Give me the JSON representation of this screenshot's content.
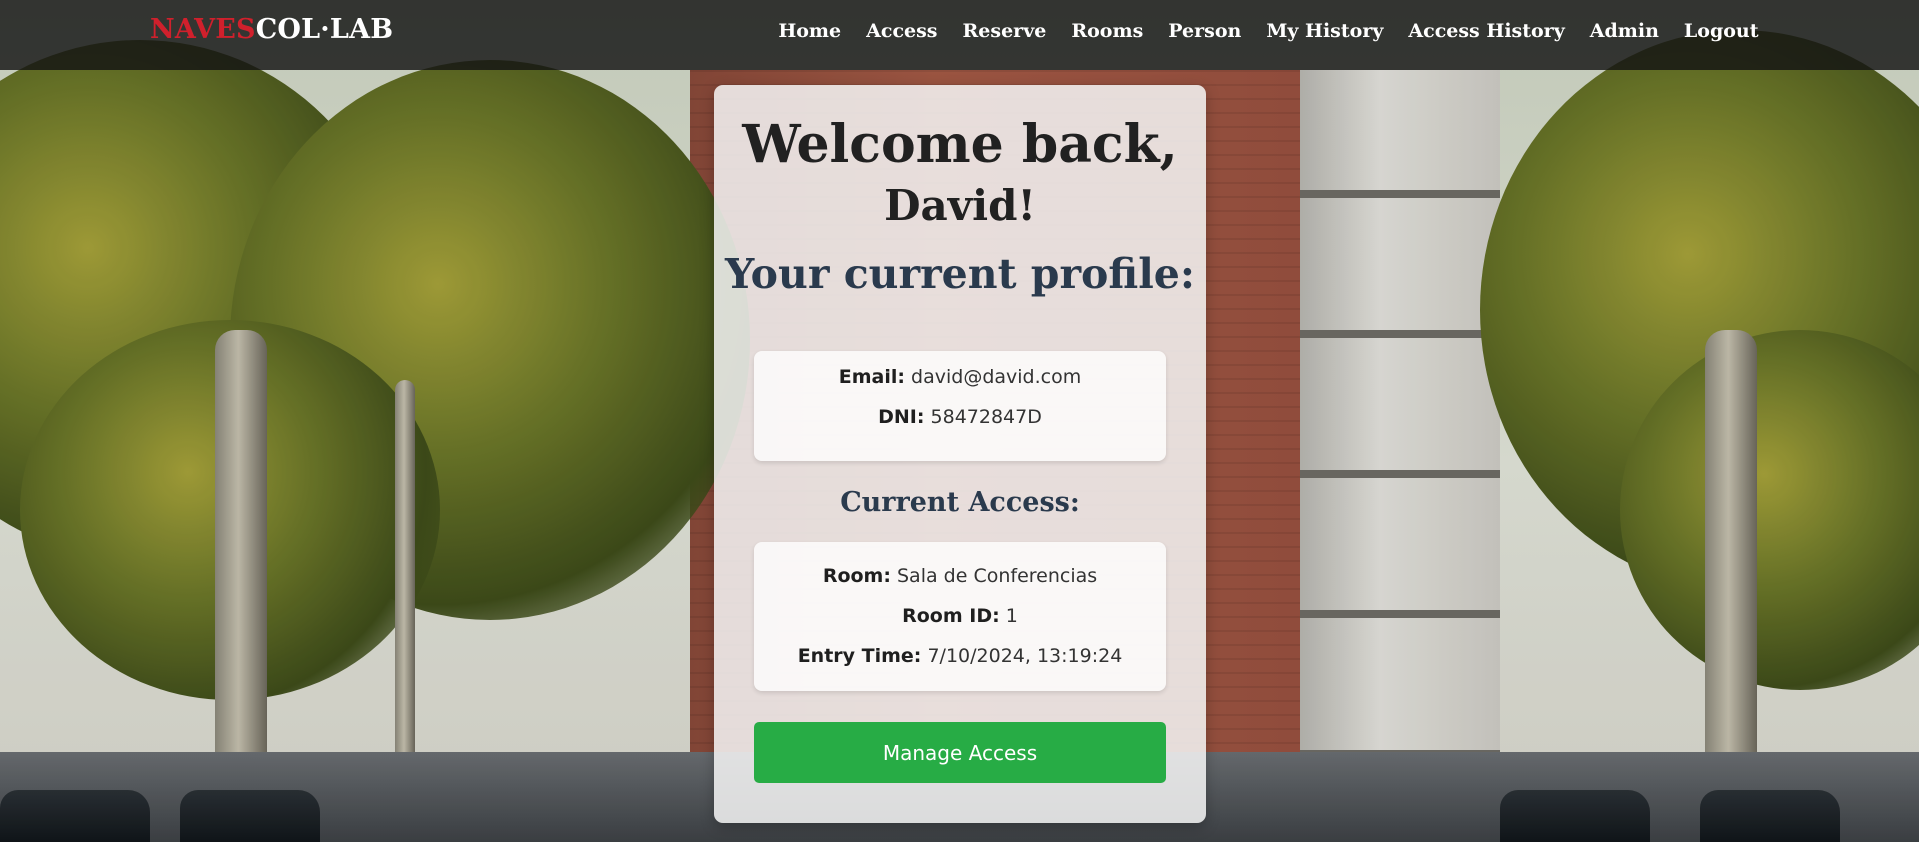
{
  "brand": {
    "part1": "NAVES",
    "part2": "COL·LAB"
  },
  "nav": [
    {
      "label": "Home"
    },
    {
      "label": "Access"
    },
    {
      "label": "Reserve"
    },
    {
      "label": "Rooms"
    },
    {
      "label": "Person"
    },
    {
      "label": "My History"
    },
    {
      "label": "Access History"
    },
    {
      "label": "Admin"
    },
    {
      "label": "Logout"
    }
  ],
  "welcome": {
    "greeting": "Welcome back,",
    "name": "David!"
  },
  "profile": {
    "title": "Your current profile:",
    "email_label": "Email:",
    "email_value": "david@david.com",
    "dni_label": "DNI:",
    "dni_value": "58472847D"
  },
  "access": {
    "title": "Current Access:",
    "room_label": "Room:",
    "room_value": "Sala de Conferencias",
    "room_id_label": "Room ID:",
    "room_id_value": "1",
    "entry_label": "Entry Time:",
    "entry_value": "7/10/2024, 13:19:24"
  },
  "manage_button": "Manage Access",
  "colors": {
    "brand_red": "#d0202c",
    "button_green": "#27ac45",
    "navbar_bg": "#141414"
  }
}
